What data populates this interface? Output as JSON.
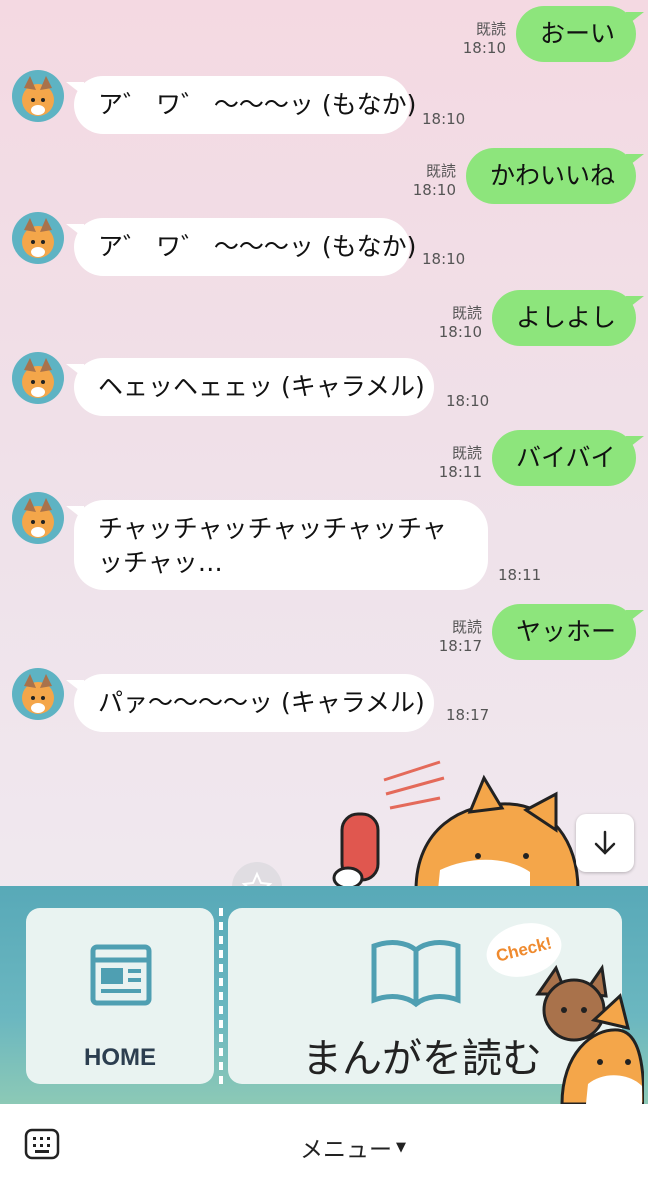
{
  "messages": [
    {
      "dir": "out",
      "text": "おーい",
      "read": "既読",
      "time": "18:10"
    },
    {
      "dir": "in",
      "text": "ア゛ ワ゛ 〜〜〜ッ (もなか)",
      "time": "18:10"
    },
    {
      "dir": "out",
      "text": "かわいいね",
      "read": "既読",
      "time": "18:10"
    },
    {
      "dir": "in",
      "text": "ア゛ ワ゛ 〜〜〜ッ (もなか)",
      "time": "18:10"
    },
    {
      "dir": "out",
      "text": "よしよし",
      "read": "既読",
      "time": "18:10"
    },
    {
      "dir": "in",
      "text": "ヘェッヘェェッ (キャラメル)",
      "time": "18:10"
    },
    {
      "dir": "out",
      "text": "バイバイ",
      "read": "既読",
      "time": "18:11"
    },
    {
      "dir": "in",
      "text": "チャッチャッチャッチャッチャッチャッ…",
      "time": "18:11"
    },
    {
      "dir": "out",
      "text": "ヤッホー",
      "read": "既読",
      "time": "18:17"
    },
    {
      "dir": "in",
      "text": "パァ〜〜〜〜ッ (キャラメル)",
      "time": "18:17"
    }
  ],
  "rich_menu": {
    "home_label": "HOME",
    "read_label": "まんがを読む",
    "check_badge": "Check!"
  },
  "bottom_bar": {
    "menu_label": "メニュー",
    "keyboard_icon": "keyboard-icon"
  },
  "icons": {
    "scroll_down": "arrow-down-icon",
    "home": "newspaper-icon",
    "book": "open-book-icon"
  },
  "colors": {
    "outgoing_bubble": "#8de57c",
    "incoming_bubble": "#ffffff",
    "menu_panel": "#58a9b8",
    "check_text": "#ef8a2e"
  }
}
